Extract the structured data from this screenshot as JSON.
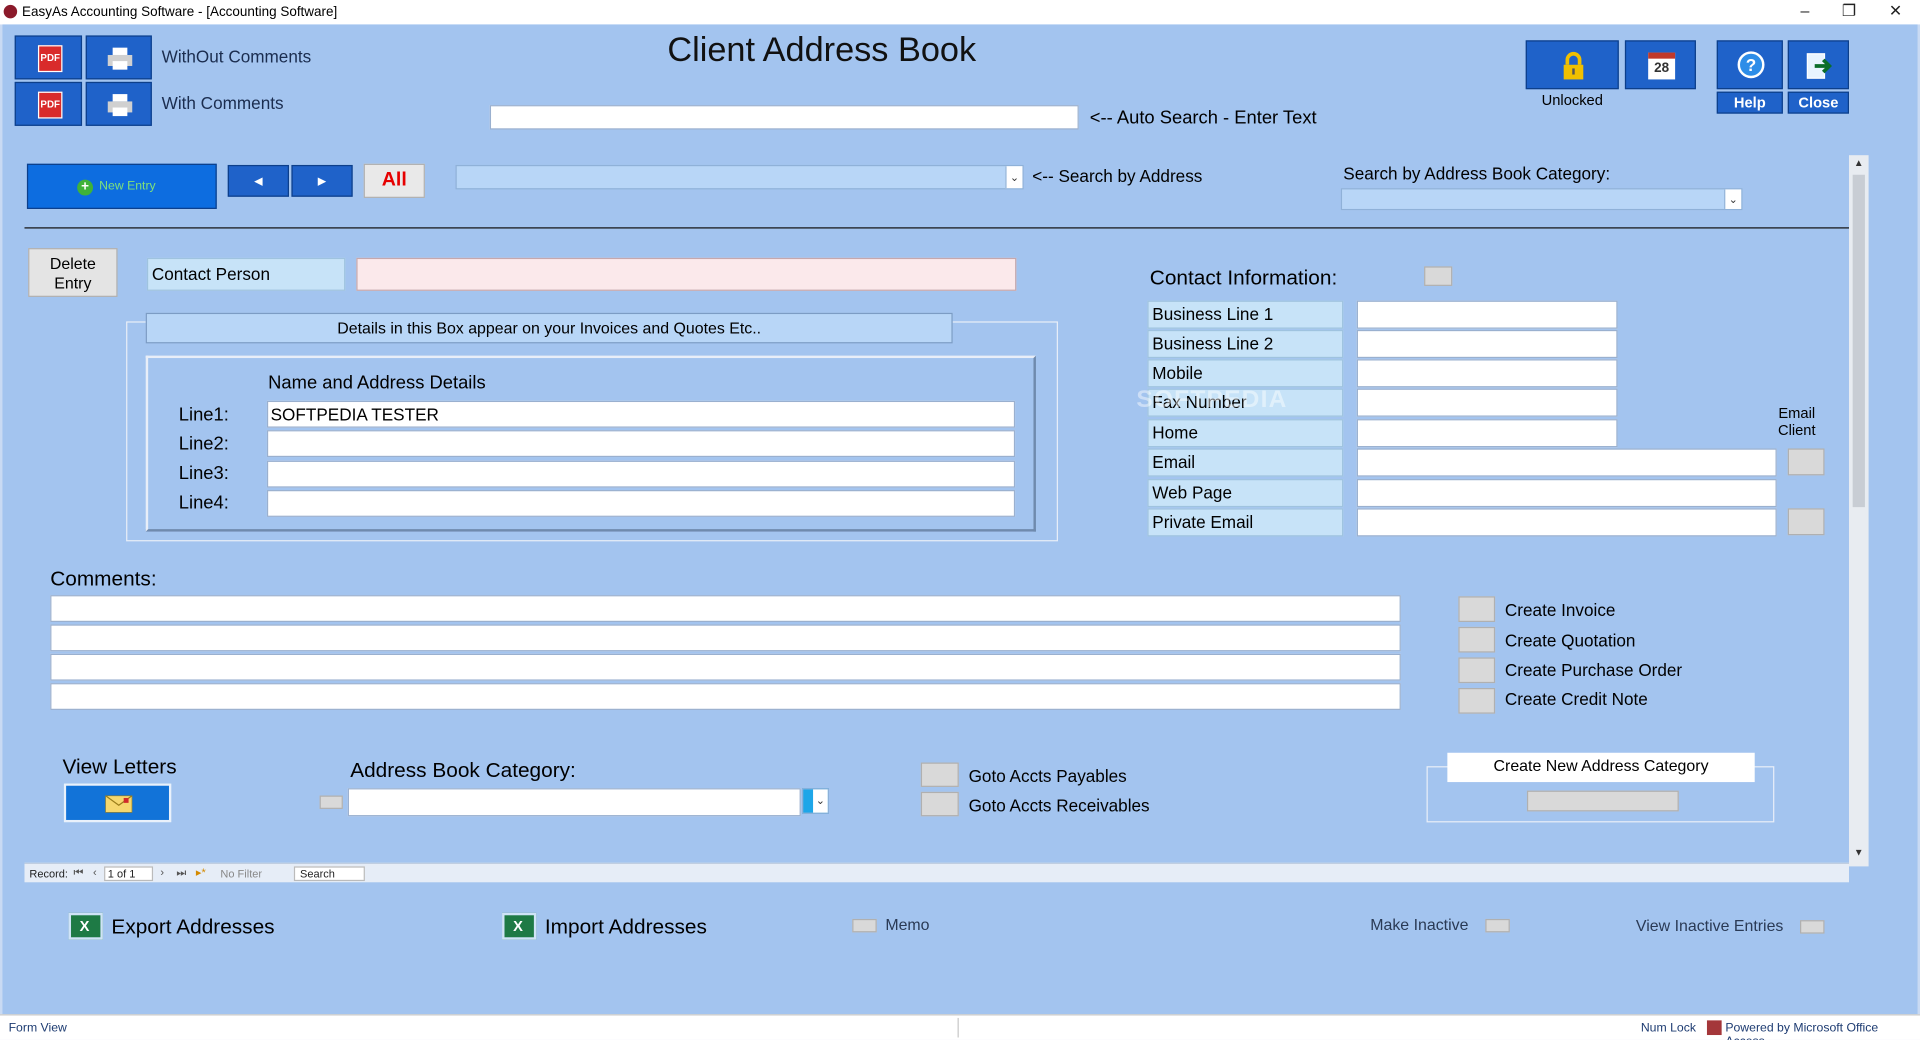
{
  "window": {
    "title": "EasyAs Accounting Software - [Accounting Software]",
    "minimize": "–",
    "restore": "❐",
    "close": "✕"
  },
  "header": {
    "title": "Client Address Book",
    "without_comments": "WithOut Comments",
    "with_comments": "With Comments",
    "pdf": "PDF",
    "unlocked": "Unlocked",
    "calendar_day": "28",
    "help": "Help",
    "close": "Close"
  },
  "search": {
    "auto_search_label": "<-- Auto Search - Enter Text",
    "auto_search_value": "",
    "by_address_label": "<-- Search  by Address",
    "by_category_label": "Search by Address Book Category:"
  },
  "toolbar": {
    "new_entry": "New Entry",
    "all": "All",
    "prev": "◀",
    "next": "▶"
  },
  "contact": {
    "delete_entry_1": "Delete",
    "delete_entry_2": "Entry",
    "contact_person_label": "Contact Person",
    "contact_person_value": "",
    "details_note": "Details in this Box appear on your Invoices and Quotes Etc..",
    "name_address_heading": "Name and  Address  Details",
    "lines": [
      {
        "label": "Line1:",
        "value": "SOFTPEDIA TESTER"
      },
      {
        "label": "Line2:",
        "value": ""
      },
      {
        "label": "Line3:",
        "value": ""
      },
      {
        "label": "Line4:",
        "value": ""
      }
    ]
  },
  "contact_info": {
    "heading": "Contact Information:",
    "fields": [
      "Business Line 1",
      "Business Line 2",
      "Mobile",
      "Fax Number",
      "Home",
      "Email",
      "Web Page",
      "Private Email"
    ],
    "email_client_1": "Email",
    "email_client_2": "Client"
  },
  "comments": {
    "heading": "Comments:"
  },
  "actions": {
    "create_invoice": "Create Invoice",
    "create_quotation": "Create Quotation",
    "create_purchase_order": "Create Purchase Order",
    "create_credit_note": "Create Credit Note"
  },
  "bottom": {
    "view_letters": "View Letters",
    "address_book_category": "Address Book Category:",
    "goto_payables": "Goto Accts Payables",
    "goto_receivables": "Goto Accts Receivables",
    "create_new_category": "Create New Address Category"
  },
  "record_nav": {
    "record_label": "Record:",
    "position": "1 of 1",
    "no_filter": "No Filter",
    "search": "Search"
  },
  "footer": {
    "export": "Export Addresses",
    "import": "Import Addresses",
    "memo": "Memo",
    "make_inactive": "Make Inactive",
    "view_inactive": "View Inactive Entries"
  },
  "status": {
    "view": "Form View",
    "num_lock": "Num Lock",
    "powered_by": "Powered by Microsoft Office Access"
  },
  "watermark": "SOFTPEDIA",
  "colors": {
    "form_bg": "#a3c4ef",
    "button_blue": "#1f62c9",
    "field_label_bg": "#c7e3f8",
    "pink_input": "#fbe9eb",
    "all_red": "#e60000"
  }
}
